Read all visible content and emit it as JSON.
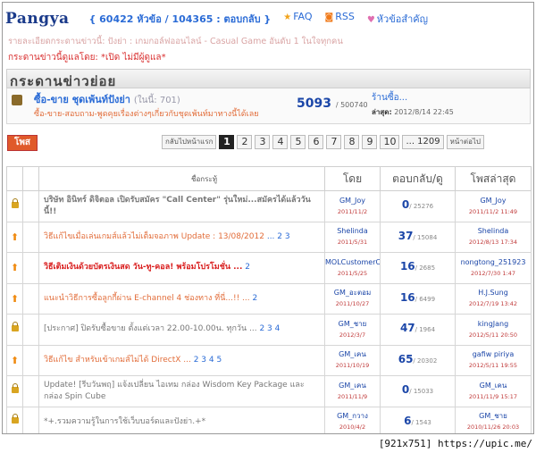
{
  "header": {
    "logo": "Pangya",
    "stats": "{ 60422 หัวข้อ / 104365 : ตอบกลับ }",
    "links": [
      {
        "icon": "star-icon",
        "glyph": "★",
        "label": "FAQ"
      },
      {
        "icon": "rss-icon",
        "glyph": "◙",
        "label": "RSS"
      },
      {
        "icon": "heart-icon",
        "glyph": "♥",
        "label": "หัวข้อสำคัญ"
      }
    ]
  },
  "board": {
    "description": "รายละเอียดกระดานข่าวนี้: ปังย่า : เกมกอล์ฟออนไลน์ - Casual Game อันดับ 1 ในใจทุกคน",
    "moderators": "กระดานข่าวนี้ดูแลโดย: *เปิด ไม่มีผู้ดูแล*",
    "title": "กระดานข่าวย่อย"
  },
  "subforum": {
    "name": "ซื้อ-ขาย ชุดเพ้นท์ปังย่า",
    "online": "(ในนี้: 701)",
    "desc": "ซื้อ-ขาย-สอบถาม-พูดคุยเรื่องต่างๆเกี่ยวกับชุดเพ้นท์มาทางนี้ได้เลย",
    "topics": "5093",
    "posts": "/ 500740",
    "last_title": "ร้านซื้อ...",
    "last_label": "ล่าสุด:",
    "last_date": "2012/8/14 22:45"
  },
  "toolbar": {
    "post_label": "โพส"
  },
  "pager": {
    "prev_label": "กลับไปหน้าแรก",
    "pages": [
      "1",
      "2",
      "3",
      "4",
      "5",
      "6",
      "7",
      "8",
      "9",
      "10"
    ],
    "current": "1",
    "last": "... 1209",
    "next_label": "หน้าต่อไป"
  },
  "table": {
    "headers": {
      "subject": "ชื่อกระทู้",
      "by": "โดย",
      "replies": "ตอบกลับ/ดู",
      "last": "โพสล่าสุด"
    },
    "rows": [
      {
        "icon": "lock",
        "style": "grey bold",
        "subject": "บริษัท อินิทร์ ดิจิตอล เปิดรับสมัคร \"Call Center\" รุ่นใหม่...สมัครได้แล้ววันนี้!!",
        "pages": "",
        "by": "GM_Joy",
        "by_date": "2011/11/2",
        "replies": "0",
        "views": "/ 25276",
        "last_by": "GM_Joy",
        "last_date": "2011/11/2 11:49"
      },
      {
        "icon": "up",
        "style": "orange",
        "subject": "วิธีแก้ไขเมื่อเล่นเกมส์แล้วไม่เต็มจอภาพ Update : 13/08/2012",
        "pages": "... 2 3",
        "by": "Shelinda",
        "by_date": "2011/5/31",
        "replies": "37",
        "views": "/ 15084",
        "last_by": "Shelinda",
        "last_date": "2012/8/13 17:34"
      },
      {
        "icon": "up",
        "style": "red",
        "subject": "วิธีเติมเงินด้วยบัตรเงินสด วัน-ทู-คอล! พร้อมโปรโมชั่น ...",
        "pages": "2",
        "by": "MOLCustomerCar",
        "by_date": "2011/5/25",
        "replies": "16",
        "views": "/ 2685",
        "last_by": "nongtong_251923",
        "last_date": "2012/7/30 1:47"
      },
      {
        "icon": "up",
        "style": "orange",
        "subject": "แนะนำวิธีการซื้อลูกกี้ผ่าน E-channel 4 ช่องทาง ที่นี่...!! ...",
        "pages": "2",
        "by": "GM_อะตอม",
        "by_date": "2011/10/27",
        "replies": "16",
        "views": "/ 6499",
        "last_by": "H.J.Sung",
        "last_date": "2012/7/19 13:42"
      },
      {
        "icon": "lock",
        "style": "grey",
        "subject": "[ประกาศ] ปิดรับซื้อขาย ตั้งแต่เวลา 22.00-10.00น. ทุกวัน ...",
        "pages": "2 3 4",
        "by": "GM_ชาย",
        "by_date": "2012/3/7",
        "replies": "47",
        "views": "/ 1964",
        "last_by": "kingJang",
        "last_date": "2012/5/11 20:50"
      },
      {
        "icon": "up",
        "style": "orange",
        "subject": "วิธีแก้ไข สำหรับเข้าเกมส์ไม่ได้ DirectX ...",
        "pages": "2 3 4 5",
        "by": "GM_เคน",
        "by_date": "2011/10/19",
        "replies": "65",
        "views": "/ 20302",
        "last_by": "gafiw piriya",
        "last_date": "2012/5/11 19:55"
      },
      {
        "icon": "lock",
        "style": "grey",
        "subject": "Update! [รีบวันพฤ] แจ้งเปลี่ยน ไอเทม กล่อง Wisdom Key Package และกล่อง Spin Cube",
        "pages": "",
        "by": "GM_เคน",
        "by_date": "2011/11/9",
        "replies": "0",
        "views": "/ 15033",
        "last_by": "GM_เคน",
        "last_date": "2011/11/9 15:17"
      },
      {
        "icon": "lock",
        "style": "grey",
        "subject": "*+.รวมความรู้ในการใช้เว็บบอร์ดและปังย่า.+*",
        "pages": "",
        "by": "GM_กวาง",
        "by_date": "2010/4/2",
        "replies": "6",
        "views": "/ 1543",
        "last_by": "GM_ชาย",
        "last_date": "2010/11/26 20:03"
      }
    ]
  },
  "footer": {
    "text": "[921x751] https://upic.me/"
  }
}
